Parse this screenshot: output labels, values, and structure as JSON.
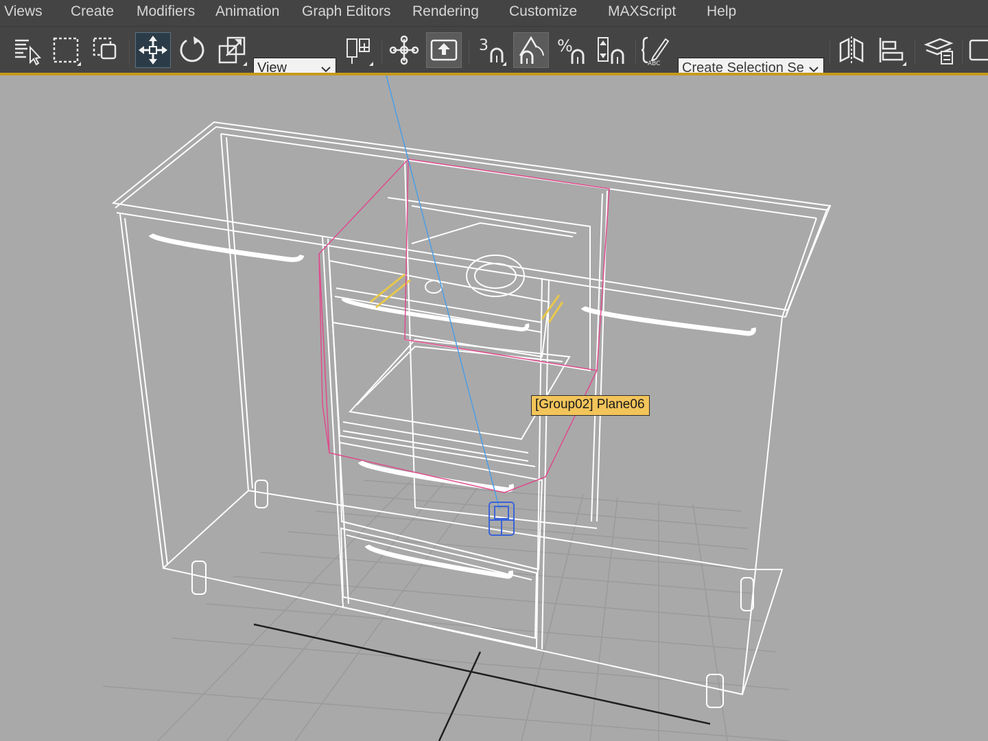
{
  "menu": {
    "items": [
      "Views",
      "Create",
      "Modifiers",
      "Animation",
      "Graph Editors",
      "Rendering",
      "Customize",
      "MAXScript",
      "Help"
    ]
  },
  "toolbar": {
    "reference_coord_system": "View",
    "named_selection_set_placeholder": "Create Selection Se",
    "snap_toggle_label": "3",
    "active_tool": "select-and-move",
    "tools": [
      "select-object-icon",
      "rectangular-selection-region-icon",
      "window-crossing-icon",
      "select-and-move-icon",
      "select-and-rotate-icon",
      "select-and-scale-icon",
      "select-and-manipulate-icon",
      "use-pivot-center-icon",
      "keyboard-shortcut-override-icon",
      "snaps-toggle-icon",
      "angle-snap-toggle-icon",
      "percent-snap-toggle-icon",
      "spinner-snap-toggle-icon",
      "edit-named-selection-sets-icon",
      "mirror-icon",
      "align-icon",
      "layer-explorer-icon"
    ],
    "accent_color": "#c79a1e"
  },
  "viewport": {
    "tooltip": "[Group02] Plane06",
    "selection_color": "#e04a8c",
    "wireframe_color": "#ffffff",
    "background_color": "#a9a9a9"
  }
}
